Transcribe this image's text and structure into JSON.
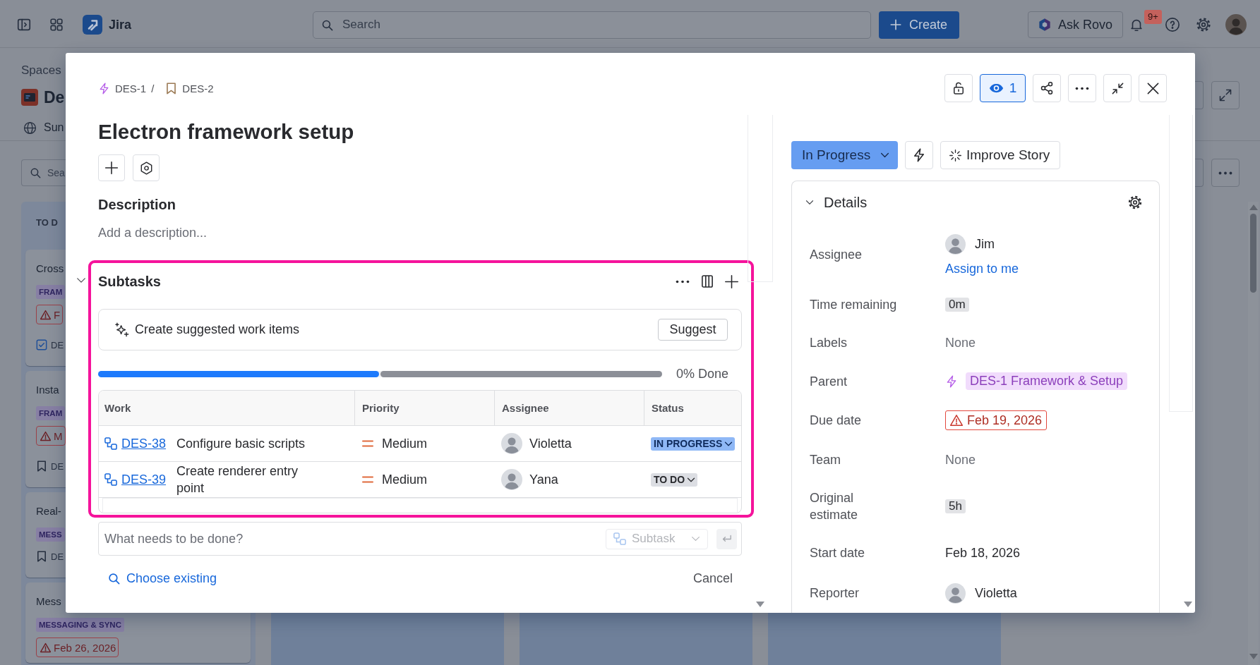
{
  "top_bar": {
    "product": "Jira",
    "search": {
      "placeholder": "Search"
    },
    "create": "Create",
    "assistant": "Ask Rovo",
    "notifications": "9+"
  },
  "space": {
    "heading": "Spaces",
    "name": "De",
    "tabs": [
      {
        "label": "Sun"
      }
    ],
    "search": {
      "placeholder": "Sea"
    }
  },
  "board": {
    "columns": [
      {
        "title": "TO D",
        "cards": [
          {
            "title": "Cross",
            "tag": "FRAM",
            "due": "F",
            "kind": "task",
            "key": "DE"
          },
          {
            "title": "Insta",
            "tag": "FRAM",
            "due": "M",
            "kind": "story",
            "key": "DE"
          },
          {
            "title": "Real-",
            "tag": "MESS",
            "kind": "story",
            "key": "DE"
          },
          {
            "title": "Mess",
            "tag": "MESSAGING & SYNC",
            "due": "Feb 26, 2026"
          }
        ]
      }
    ]
  },
  "work_item": {
    "breadcrumbs": [
      {
        "kind": "epic",
        "key": "DES-1"
      },
      {
        "kind": "story",
        "key": "DES-2"
      }
    ],
    "breadcrumb_separator": "/",
    "watch": {
      "count": "1",
      "selected": true
    },
    "title": "Electron framework setup",
    "description": {
      "heading": "Description",
      "placeholder": "Add a description..."
    },
    "subtasks": {
      "heading": "Subtasks",
      "expanded": true,
      "highlighted": true,
      "suggestion": {
        "text": "Create suggested work items",
        "button": "Suggest"
      },
      "progress": {
        "segments": [
          {
            "kind": "in_progress",
            "level": 0.5
          },
          {
            "kind": "to_do",
            "level": 0.5
          }
        ],
        "label": "0% Done"
      },
      "columns": [
        "Work",
        "Priority",
        "Assignee",
        "Status"
      ],
      "rows": [
        {
          "key": "DES-38",
          "summary": "Configure basic scripts",
          "priority": "Medium",
          "assignee": "Violetta",
          "status": {
            "label": "IN PROGRESS",
            "kind": "in_progress"
          }
        },
        {
          "key": "DES-39",
          "summary": "Create renderer entry point",
          "priority": "Medium",
          "assignee": "Yana",
          "status": {
            "label": "TO DO",
            "kind": "to_do"
          }
        }
      ],
      "new_item": {
        "placeholder": "What needs to be done?",
        "type": {
          "label": "Subtask",
          "disabled": true
        },
        "submit_disabled": true
      },
      "choose_existing": "Choose existing",
      "cancel": "Cancel"
    },
    "status": {
      "label": "In Progress",
      "kind": "in_progress"
    },
    "improve": "Improve Story",
    "details": {
      "heading": "Details",
      "expanded": true,
      "fields": [
        {
          "kind": "user",
          "label": "Assignee",
          "value": "Jim",
          "link": "Assign to me"
        },
        {
          "kind": "chip",
          "label": "Time remaining",
          "value": "0m"
        },
        {
          "kind": "empty",
          "label": "Labels",
          "value": "None"
        },
        {
          "kind": "parent",
          "label": "Parent",
          "value": "DES-1 Framework & Setup"
        },
        {
          "kind": "due",
          "label": "Due date",
          "value": "Feb 19, 2026"
        },
        {
          "kind": "empty",
          "label": "Team",
          "value": "None"
        },
        {
          "kind": "chip",
          "label": "Original estimate",
          "value": "5h"
        },
        {
          "kind": "text",
          "label": "Start date",
          "value": "Feb 18, 2026"
        },
        {
          "kind": "user",
          "label": "Reporter",
          "value": "Violetta"
        }
      ]
    }
  }
}
